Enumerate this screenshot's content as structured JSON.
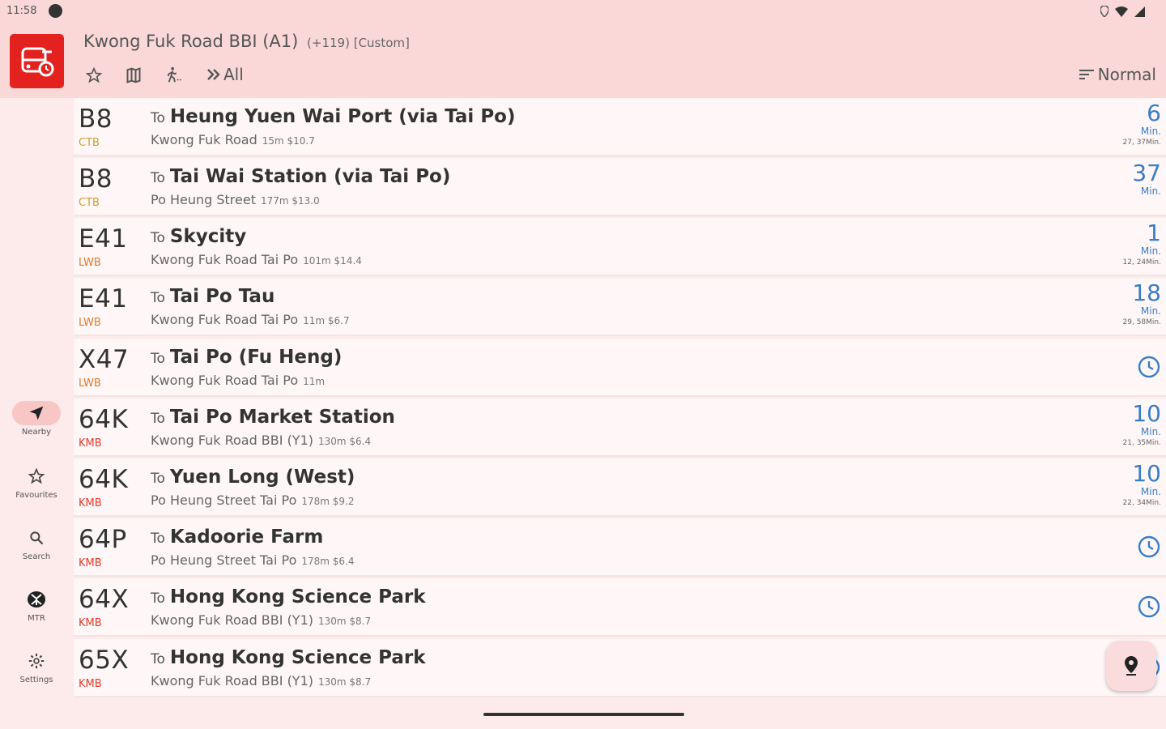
{
  "status": {
    "time": "11:58"
  },
  "header": {
    "title": "Kwong Fuk Road BBI (A1)",
    "title_extra": "(+119) [Custom]",
    "all_label": "All",
    "sort_label": "Normal"
  },
  "nav": [
    {
      "label": "Nearby",
      "icon": "navigation-arrow-icon"
    },
    {
      "label": "Favourites",
      "icon": "star-icon"
    },
    {
      "label": "Search",
      "icon": "search-icon"
    },
    {
      "label": "MTR",
      "icon": "mtr-icon"
    },
    {
      "label": "Settings",
      "icon": "gear-icon"
    }
  ],
  "colors": {
    "ctb": "#c9a32b",
    "lwb": "#e07a2a",
    "kmb": "#e33a2a",
    "eta": "#3a7dc8",
    "header": "#fad8d8",
    "logo": "#e3211f"
  },
  "rows": [
    {
      "route": "B8",
      "company": "CTB",
      "to": "To",
      "destination": "Heung Yuen Wai Port (via Tai Po)",
      "stop": "Kwong Fuk Road",
      "meta": "15m $10.7",
      "eta": "6",
      "unit": "Min.",
      "next": "27, 37Min."
    },
    {
      "route": "B8",
      "company": "CTB",
      "to": "To",
      "destination": "Tai Wai Station (via Tai Po)",
      "stop": "Po Heung Street",
      "meta": "177m $13.0",
      "eta": "37",
      "unit": "Min.",
      "next": ""
    },
    {
      "route": "E41",
      "company": "LWB",
      "to": "To",
      "destination": "Skycity",
      "stop": "Kwong Fuk Road Tai Po",
      "meta": "101m $14.4",
      "eta": "1",
      "unit": "Min.",
      "next": "12, 24Min."
    },
    {
      "route": "E41",
      "company": "LWB",
      "to": "To",
      "destination": "Tai Po Tau",
      "stop": "Kwong Fuk Road Tai Po",
      "meta": "11m $6.7",
      "eta": "18",
      "unit": "Min.",
      "next": "29, 58Min."
    },
    {
      "route": "X47",
      "company": "LWB",
      "to": "To",
      "destination": "Tai Po (Fu Heng)",
      "stop": "Kwong Fuk Road Tai Po",
      "meta": "11m",
      "eta": "",
      "unit": "",
      "next": ""
    },
    {
      "route": "64K",
      "company": "KMB",
      "to": "To",
      "destination": "Tai Po Market Station",
      "stop": "Kwong Fuk Road BBI (Y1)",
      "meta": "130m $6.4",
      "eta": "10",
      "unit": "Min.",
      "next": "21, 35Min."
    },
    {
      "route": "64K",
      "company": "KMB",
      "to": "To",
      "destination": "Yuen Long (West)",
      "stop": "Po Heung Street Tai Po",
      "meta": "178m $9.2",
      "eta": "10",
      "unit": "Min.",
      "next": "22, 34Min."
    },
    {
      "route": "64P",
      "company": "KMB",
      "to": "To",
      "destination": "Kadoorie Farm",
      "stop": "Po Heung Street Tai Po",
      "meta": "178m $6.4",
      "eta": "",
      "unit": "",
      "next": ""
    },
    {
      "route": "64X",
      "company": "KMB",
      "to": "To",
      "destination": "Hong Kong Science Park",
      "stop": "Kwong Fuk Road BBI (Y1)",
      "meta": "130m $8.7",
      "eta": "",
      "unit": "",
      "next": ""
    },
    {
      "route": "65X",
      "company": "KMB",
      "to": "To",
      "destination": "Hong Kong Science Park",
      "stop": "Kwong Fuk Road BBI (Y1)",
      "meta": "130m $8.7",
      "eta": "",
      "unit": "",
      "next": ""
    }
  ]
}
